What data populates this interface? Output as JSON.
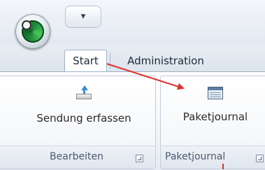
{
  "app": {
    "orb_icon": "app-orb-icon",
    "qat_icon": "quick-access-dropdown-icon",
    "qat_glyph": "▾"
  },
  "tabs": [
    {
      "label": "Start",
      "selected": true
    },
    {
      "label": "Administration",
      "selected": false
    }
  ],
  "groups": [
    {
      "caption": "Bearbeiten",
      "button_label": "Sendung erfassen",
      "button_icon": "send-parcel-icon"
    },
    {
      "caption": "Paketjournal",
      "button_label": "Paketjournal",
      "button_icon": "journal-table-icon"
    }
  ],
  "annotation": {
    "color": "#e03131"
  },
  "colors": {
    "tab_border": "#9fb0c4",
    "caption_text": "#4b5b72"
  }
}
